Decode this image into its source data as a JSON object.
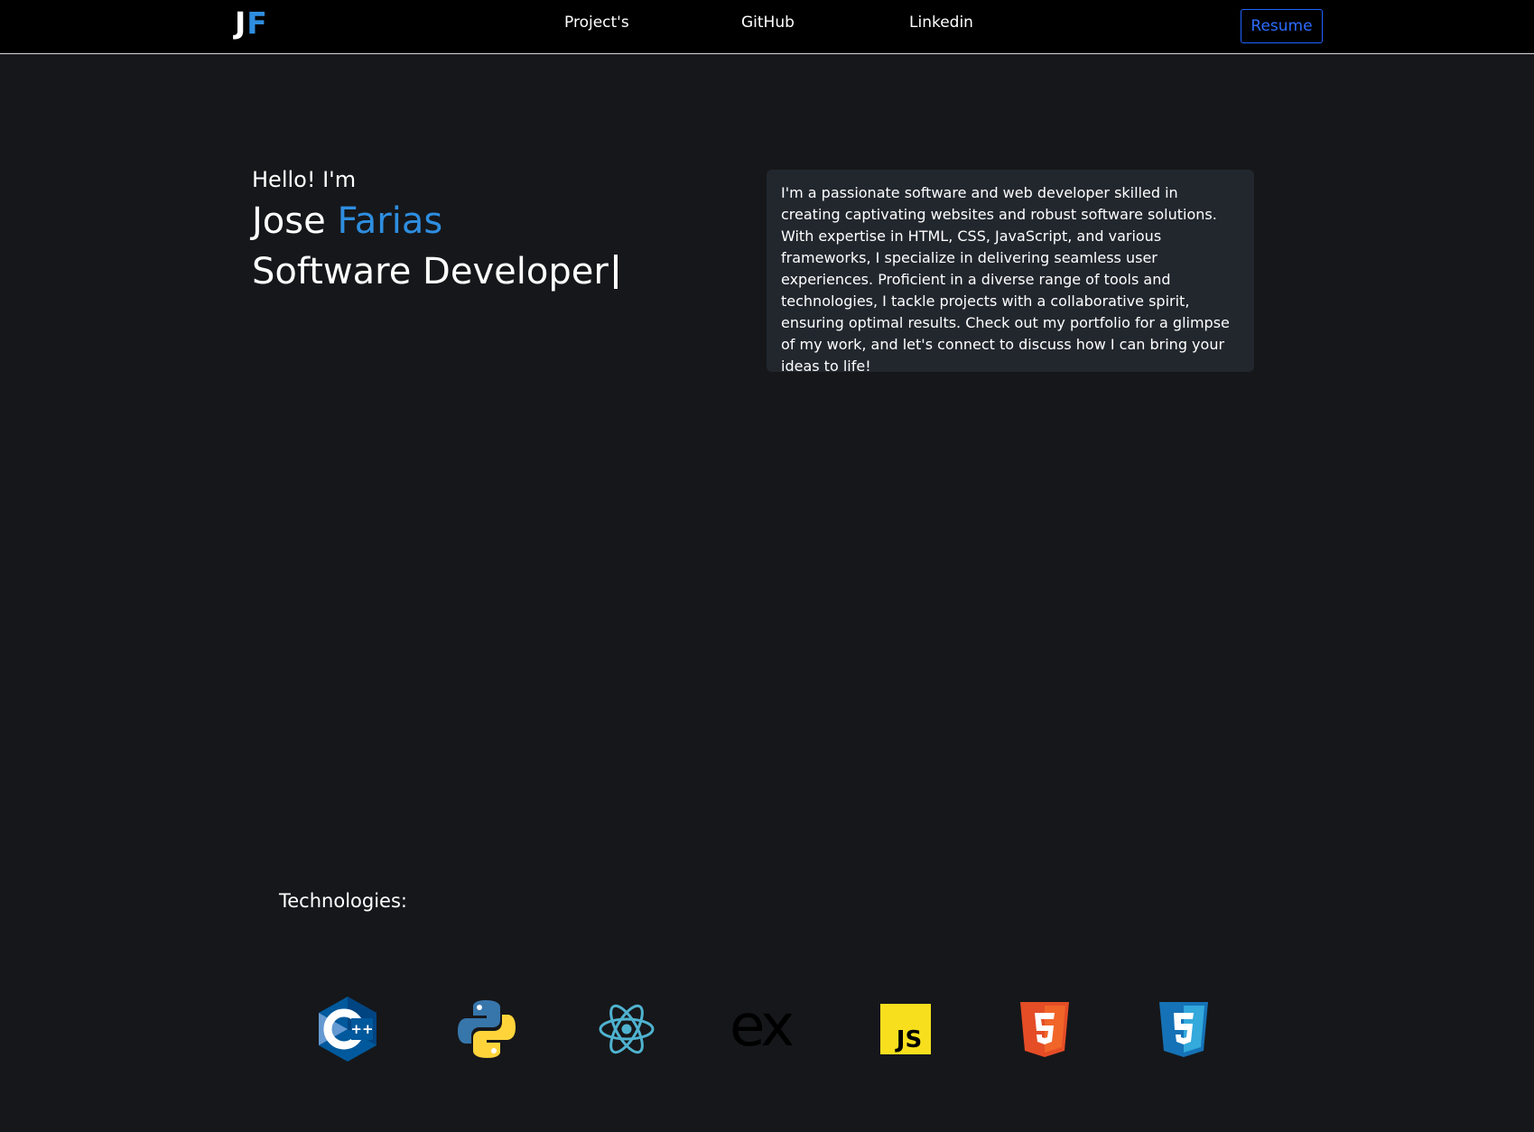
{
  "nav": {
    "logo_first": "J",
    "logo_second": "F",
    "links": [
      "Project's",
      "GitHub",
      "Linkedin"
    ],
    "resume_label": "Resume"
  },
  "hero": {
    "greeting": "Hello! I'm",
    "first_name": "Jose",
    "last_name": "Farias",
    "role": "Software Developer"
  },
  "about": {
    "text": "I'm a passionate software and web developer skilled in creating captivating websites and robust software solutions. With expertise in HTML, CSS, JavaScript, and various frameworks, I specialize in delivering seamless user experiences. Proficient in a diverse range of tools and technologies, I tackle projects with a collaborative spirit, ensuring optimal results. Check out my portfolio for a glimpse of my work, and let's connect to discuss how I can bring your ideas to life!"
  },
  "technologies": {
    "heading": "Technologies:",
    "icons": [
      "cpp-icon",
      "python-icon",
      "react-icon",
      "express-icon",
      "javascript-icon",
      "html5-icon",
      "css3-icon"
    ]
  },
  "colors": {
    "background": "#16171a",
    "navbar": "#000000",
    "accent": "#2e8ee0",
    "resume_button": "#1e63ff",
    "card": "#22272e"
  }
}
